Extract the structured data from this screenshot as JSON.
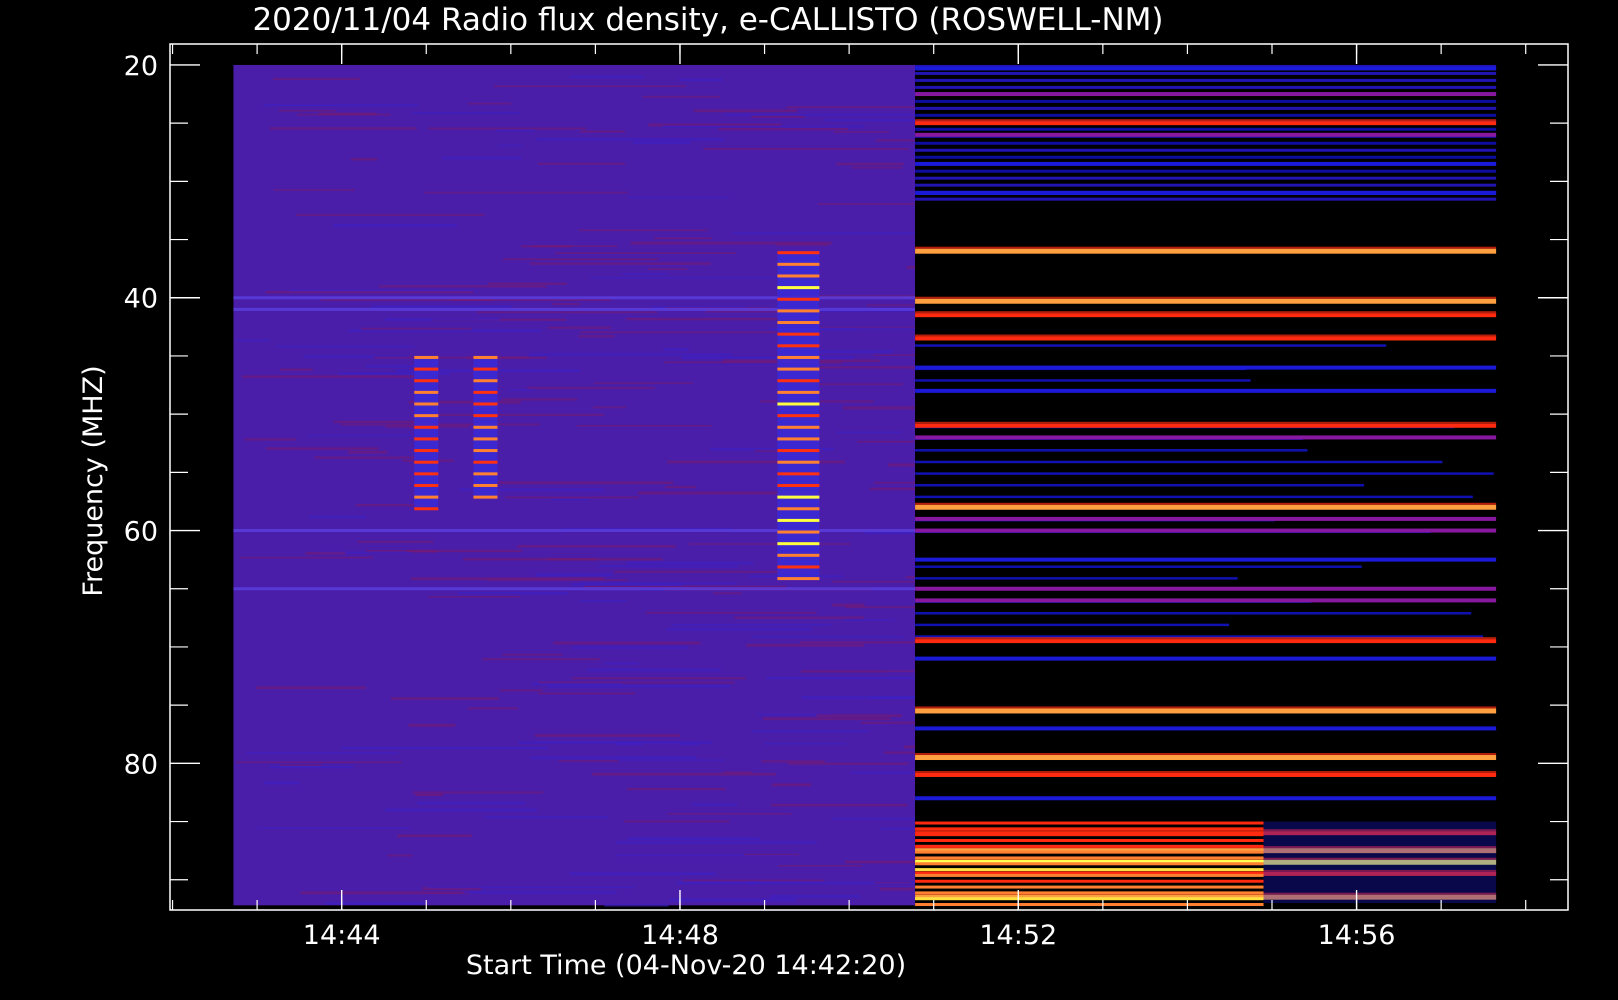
{
  "chart_data": {
    "type": "heatmap",
    "title": "2020/11/04  Radio flux density, e-CALLISTO (ROSWELL-NM)",
    "xlabel": "Start Time (04-Nov-20 14:42:20)",
    "ylabel": "Frequency (MHZ)",
    "x_axis": {
      "unit": "time (HH:MM on 2020-11-04)",
      "range_minutes_after_14_40": [
        1.97,
        18.5
      ],
      "ticks": [
        {
          "label": "14:44",
          "minutes_after_14_40": 4
        },
        {
          "label": "14:48",
          "minutes_after_14_40": 8
        },
        {
          "label": "14:52",
          "minutes_after_14_40": 12
        },
        {
          "label": "14:56",
          "minutes_after_14_40": 16
        }
      ],
      "minor_tick_minutes_after_14_40": [
        2.0,
        3.0,
        4.0,
        5.0,
        6.0,
        7.0,
        8.0,
        9.0,
        10.0,
        11.0,
        12.0,
        13.0,
        14.0,
        15.0,
        16.0,
        17.0,
        18.0
      ]
    },
    "y_axis": {
      "unit": "MHz",
      "inverted": true,
      "range": [
        18.2,
        92.6
      ],
      "ticks": [
        20,
        40,
        60,
        80
      ],
      "minor_ticks": [
        25,
        30,
        35,
        45,
        50,
        55,
        65,
        70,
        75,
        85,
        90
      ]
    },
    "data_extent": {
      "start_minutes_after_14_40": 2.72,
      "end_minutes_after_14_40": 17.65,
      "freq_top_mhz": 20,
      "freq_bottom_mhz": 92.2
    },
    "background_segment": {
      "end_minutes_after_14_40": 10.78,
      "level": "low-moderate (purple)",
      "horizontal_lines_mhz": [
        40,
        41,
        60,
        65
      ]
    },
    "bursts": [
      {
        "center_minutes_after_14_40": 5.0,
        "freq_mhz": [
          45,
          58
        ],
        "intensity": "red"
      },
      {
        "center_minutes_after_14_40": 5.7,
        "freq_mhz": [
          45,
          57
        ],
        "intensity": "red"
      },
      {
        "center_minutes_after_14_40": 9.4,
        "freq_mhz": [
          36,
          64
        ],
        "intensity": "red-yellow"
      }
    ],
    "emission_bands": [
      {
        "freq_mhz": 20.3,
        "level": 1
      },
      {
        "freq_mhz": 22.5,
        "level": 2
      },
      {
        "freq_mhz": 25.0,
        "level": 3
      },
      {
        "freq_mhz": 26.0,
        "level": 2
      },
      {
        "freq_mhz": 28.5,
        "level": 1
      },
      {
        "freq_mhz": 31.0,
        "level": 1
      },
      {
        "freq_mhz": 36.0,
        "level": 4
      },
      {
        "freq_mhz": 40.3,
        "level": 4
      },
      {
        "freq_mhz": 41.5,
        "level": 3
      },
      {
        "freq_mhz": 43.5,
        "level": 3
      },
      {
        "freq_mhz": 46.0,
        "level": 1
      },
      {
        "freq_mhz": 48.0,
        "level": 1
      },
      {
        "freq_mhz": 51.0,
        "level": 3
      },
      {
        "freq_mhz": 52.0,
        "level": 2
      },
      {
        "freq_mhz": 58.0,
        "level": 4
      },
      {
        "freq_mhz": 59.0,
        "level": 2
      },
      {
        "freq_mhz": 60.0,
        "level": 2
      },
      {
        "freq_mhz": 62.5,
        "level": 1
      },
      {
        "freq_mhz": 65.0,
        "level": 2
      },
      {
        "freq_mhz": 66.0,
        "level": 2
      },
      {
        "freq_mhz": 69.5,
        "level": 3
      },
      {
        "freq_mhz": 71.0,
        "level": 1
      },
      {
        "freq_mhz": 75.5,
        "level": 4
      },
      {
        "freq_mhz": 77.0,
        "level": 1
      },
      {
        "freq_mhz": 79.5,
        "level": 4
      },
      {
        "freq_mhz": 81.0,
        "level": 3
      },
      {
        "freq_mhz": 83.0,
        "level": 1
      },
      {
        "freq_mhz": 86.0,
        "level": 3
      },
      {
        "freq_mhz": 87.5,
        "level": 4
      },
      {
        "freq_mhz": 88.5,
        "level": 5
      },
      {
        "freq_mhz": 89.5,
        "level": 3
      },
      {
        "freq_mhz": 91.5,
        "level": 4
      }
    ],
    "broadband_enhancement": {
      "freq_mhz": [
        85,
        92
      ],
      "end_minutes_after_14_40": 14.9
    },
    "colormap": [
      "#000000",
      "#2010c0",
      "#2a1acf",
      "#3a2fd8",
      "#cc1010",
      "#ff5010",
      "#ffb050",
      "#ffff40"
    ],
    "grid": false,
    "legend": "none"
  }
}
